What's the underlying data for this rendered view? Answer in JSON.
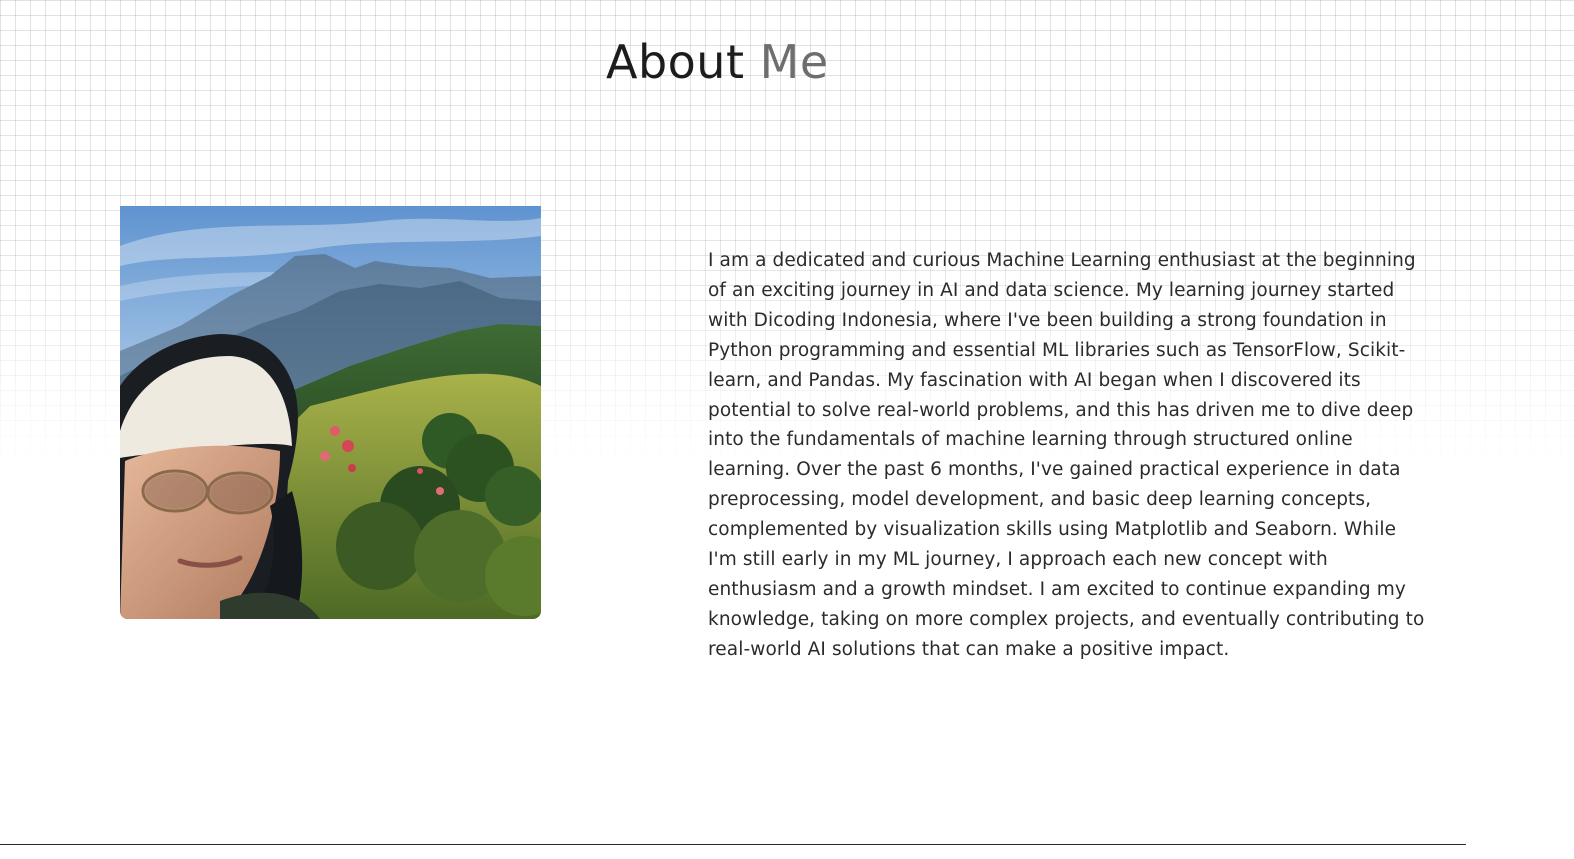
{
  "section": {
    "title_main": "About",
    "title_accent": "Me"
  },
  "photo": {
    "alt": "Portrait selfie in front of mountains"
  },
  "bio": {
    "paragraph": "I am a dedicated and curious Machine Learning enthusiast at the beginning of an exciting journey in AI and data science. My learning journey started with Dicoding Indonesia, where I've been building a strong foundation in Python programming and essential ML libraries such as TensorFlow, Scikit-learn, and Pandas. My fascination with AI began when I discovered its potential to solve real-world problems, and this has driven me to dive deep into the fundamentals of machine learning through structured online learning. Over the past 6 months, I've gained practical experience in data preprocessing, model development, and basic deep learning concepts, complemented by visualization skills using Matplotlib and Seaborn. While I'm still early in my ML journey, I approach each new concept with enthusiasm and a growth mindset. I am excited to continue expanding my knowledge, taking on more complex projects, and eventually contributing to real-world AI solutions that can make a positive impact."
  },
  "colors": {
    "title": "#1c1c1c",
    "title_accent": "#6e6e6e",
    "body_text": "#2b2b2b",
    "grid_line": "#dcdcdf"
  }
}
